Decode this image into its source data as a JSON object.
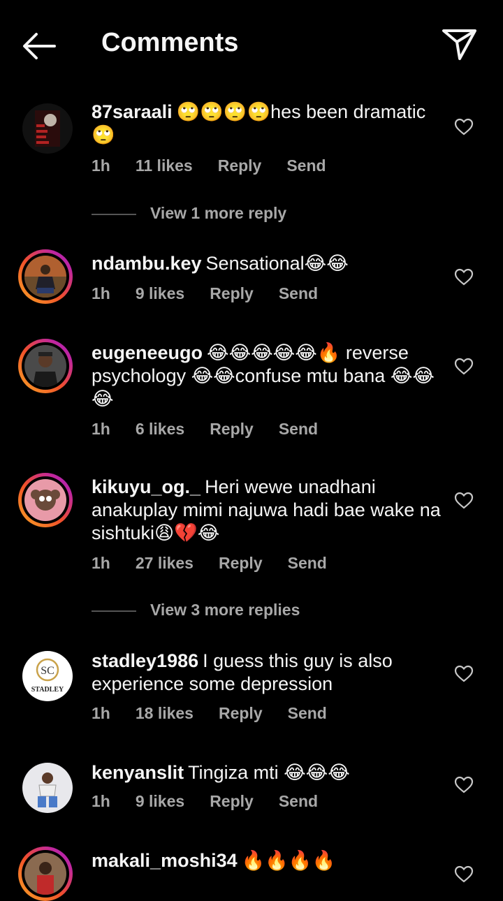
{
  "header": {
    "title": "Comments"
  },
  "comments": [
    {
      "user": "87saraali",
      "text": "🙄🙄🙄🙄hes been dramatic 🙄",
      "time": "1h",
      "likes": "11 likes",
      "reply": "Reply",
      "send": "Send"
    },
    {
      "user": "ndambu.key",
      "text": "Sensational😂😂",
      "time": "1h",
      "likes": "9 likes",
      "reply": "Reply",
      "send": "Send"
    },
    {
      "user": "eugeneeugo",
      "text": "😂😂😂😂😂🔥 reverse psychology 😂😂confuse mtu bana 😂😂😂",
      "time": "1h",
      "likes": "6 likes",
      "reply": "Reply",
      "send": "Send"
    },
    {
      "user": "kikuyu_og._",
      "text": "Heri wewe unadhani anakuplay mimi najuwa hadi bae wake na sishtuki😩💔😂",
      "time": "1h",
      "likes": "27 likes",
      "reply": "Reply",
      "send": "Send"
    },
    {
      "user": "stadley1986",
      "text": "I guess this guy is also experience some depression",
      "time": "1h",
      "likes": "18 likes",
      "reply": "Reply",
      "send": "Send"
    },
    {
      "user": "kenyanslit",
      "text": "Tingiza mti 😂😂😂",
      "time": "1h",
      "likes": "9 likes",
      "reply": "Reply",
      "send": "Send"
    },
    {
      "user": "makali_moshi34",
      "text": "🔥🔥🔥🔥"
    }
  ],
  "view_more": [
    "View 1 more reply",
    "View 3 more replies"
  ],
  "avatar_logo": {
    "brand": "STADLEY",
    "initials": "SC"
  },
  "colors": {
    "background": "#000000",
    "text": "#f5f5f5",
    "secondary": "#a8a8a8",
    "story_ring": "#e1306c"
  }
}
